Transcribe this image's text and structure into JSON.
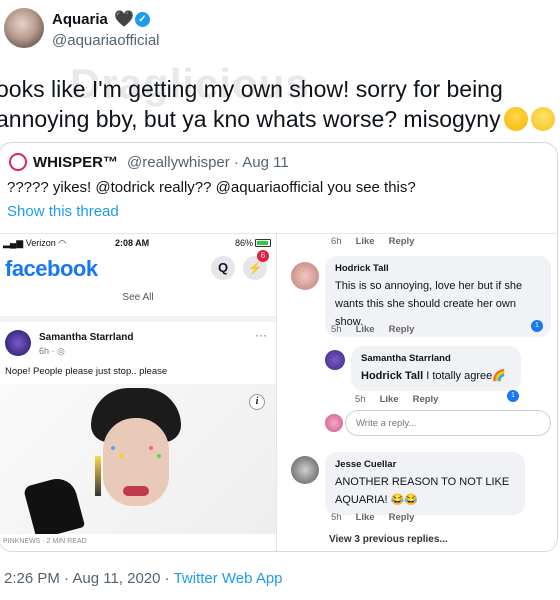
{
  "tweet": {
    "author_name": "Aquaria",
    "author_handle": "@aquariaofficial",
    "heart_symbol": "🖤",
    "verified_symbol": "✓",
    "watermark": "Draglicious",
    "text": "ooks like I'm getting my own show! sorry for being\nannoying bby, but ya kno whats worse? misogyny",
    "emojis": [
      "heart-eyes-emoji",
      "smiling-face-emoji"
    ],
    "timestamp": "2:26 PM · Aug 11, 2020",
    "via": "Twitter Web App",
    "via_separator": " · "
  },
  "quoted": {
    "author_name": "WHISPER™",
    "author_handle": "@reallywhisper · Aug 11",
    "text": "????? yikes! @todrick really?? @aquariaofficial you see this?",
    "show_thread": "Show this thread"
  },
  "phone_left": {
    "carrier": "Verizon",
    "time": "2:08 AM",
    "battery": "86%",
    "logo": "facebook",
    "search_glyph": "Q",
    "messenger_glyph": "⚡",
    "notification_count": "6",
    "see_all": "See All",
    "post": {
      "author": "Samantha Starrland",
      "time": "6h · ",
      "text": "Nope! People please just stop.. please",
      "more_glyph": "···",
      "info_glyph": "i",
      "footer_text": "PINKNEWS · 2 MIN READ"
    }
  },
  "phone_right": {
    "top_meta": {
      "age": "6h",
      "like": "Like",
      "reply": "Reply"
    },
    "comments": [
      {
        "author": "Hodrick Tall",
        "text": "This is so annoying, love her but if she wants this she should create her own show.",
        "age": "5h",
        "like": "Like",
        "reply": "Reply",
        "reactions": "1"
      },
      {
        "author": "Samantha Starrland",
        "mention": "Hodrick Tall",
        "text": " I totally agree🌈",
        "age": "5h",
        "like": "Like",
        "reply": "Reply",
        "reactions": "1"
      },
      {
        "author": "Jesse Cuellar",
        "text": "ANOTHER REASON TO NOT LIKE AQUARIA! 😂😂",
        "age": "5h",
        "like": "Like",
        "reply": "Reply"
      }
    ],
    "reply_placeholder": "Write a reply...",
    "view_more": "View 3 previous replies..."
  },
  "colors": {
    "twitter_blue": "#1d9bf0",
    "facebook_blue": "#1877f2",
    "muted_text": "#536471",
    "border": "#cfd9de"
  }
}
